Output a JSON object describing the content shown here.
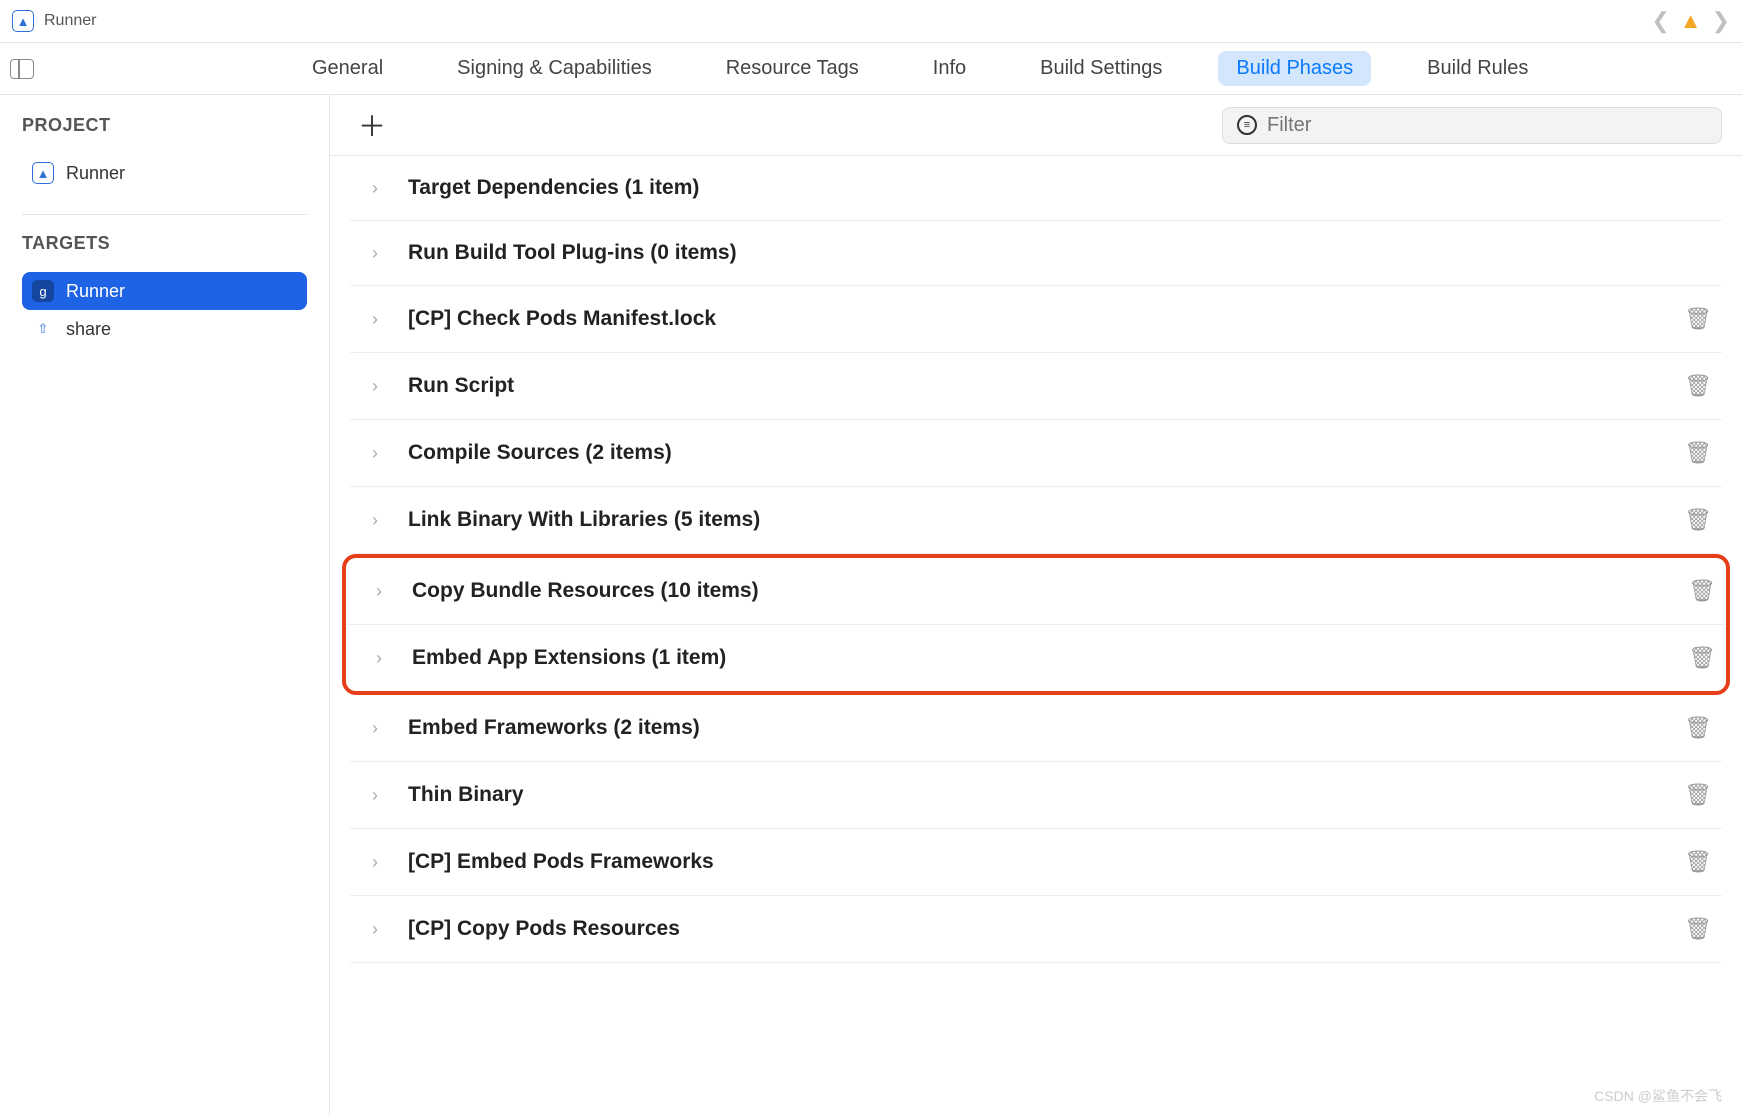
{
  "titlebar": {
    "app_name": "Runner"
  },
  "tabs": {
    "items": [
      "General",
      "Signing & Capabilities",
      "Resource Tags",
      "Info",
      "Build Settings",
      "Build Phases",
      "Build Rules"
    ],
    "active_index": 5
  },
  "sidebar": {
    "project_label": "PROJECT",
    "project_item": "Runner",
    "targets_label": "TARGETS",
    "targets": [
      {
        "name": "Runner",
        "selected": true,
        "icon": "app"
      },
      {
        "name": "share",
        "selected": false,
        "icon": "upload"
      }
    ]
  },
  "toolbar": {
    "filter_placeholder": "Filter"
  },
  "phases": [
    {
      "label": "Target Dependencies (1 item)",
      "deletable": false
    },
    {
      "label": "Run Build Tool Plug-ins (0 items)",
      "deletable": false
    },
    {
      "label": "[CP] Check Pods Manifest.lock",
      "deletable": true
    },
    {
      "label": "Run Script",
      "deletable": true
    },
    {
      "label": "Compile Sources (2 items)",
      "deletable": true
    },
    {
      "label": "Link Binary With Libraries (5 items)",
      "deletable": true
    },
    {
      "label": "Copy Bundle Resources (10 items)",
      "deletable": true,
      "highlighted": true
    },
    {
      "label": "Embed App Extensions (1 item)",
      "deletable": true,
      "highlighted": true
    },
    {
      "label": "Embed Frameworks (2 items)",
      "deletable": true
    },
    {
      "label": "Thin Binary",
      "deletable": true
    },
    {
      "label": "[CP] Embed Pods Frameworks",
      "deletable": true
    },
    {
      "label": "[CP] Copy Pods Resources",
      "deletable": true
    }
  ],
  "watermark": "CSDN @鲨鱼不会飞"
}
